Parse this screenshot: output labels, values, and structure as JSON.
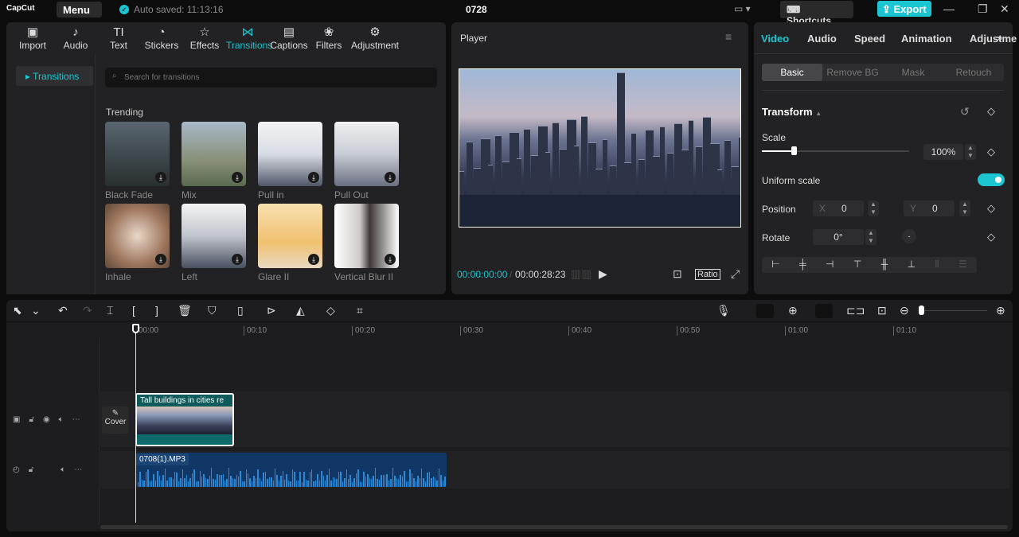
{
  "app": {
    "logo": "CapCut",
    "menu": "Menu",
    "autosave": "Auto saved: 11:13:16",
    "project": "0728",
    "shortcuts": "Shortcuts",
    "export": "Export"
  },
  "media_tabs": [
    {
      "icon": "▣",
      "label": "Import"
    },
    {
      "icon": "♪",
      "label": "Audio"
    },
    {
      "icon": "TI",
      "label": "Text"
    },
    {
      "icon": "◔",
      "label": "Stickers"
    },
    {
      "icon": "☆",
      "label": "Effects"
    },
    {
      "icon": "⋈",
      "label": "Transitions"
    },
    {
      "icon": "▤",
      "label": "Captions"
    },
    {
      "icon": "❀",
      "label": "Filters"
    },
    {
      "icon": "⚙",
      "label": "Adjustment"
    }
  ],
  "sidebar": {
    "item": "Transitions"
  },
  "search": {
    "placeholder": "Search for transitions"
  },
  "section": "Trending",
  "transitions": [
    "Black Fade",
    "Mix",
    "Pull in",
    "Pull Out",
    "Inhale",
    "Left",
    "Glare II",
    "Vertical Blur II"
  ],
  "player": {
    "title": "Player",
    "current": "00:00:00:00",
    "total": "00:00:28:23",
    "ratio": "Ratio"
  },
  "inspector": {
    "tabs": [
      "Video",
      "Audio",
      "Speed",
      "Animation",
      "Adjustme"
    ],
    "subtabs": [
      "Basic",
      "Remove BG",
      "Mask",
      "Retouch"
    ],
    "section": "Transform",
    "scale_label": "Scale",
    "scale_value": "100%",
    "scale_fraction": 0.2,
    "uniform_label": "Uniform scale",
    "uniform_on": true,
    "position_label": "Position",
    "x_label": "X",
    "x_value": "0",
    "y_label": "Y",
    "y_value": "0",
    "rotate_label": "Rotate",
    "rotate_value": "0°"
  },
  "timeline": {
    "ticks": [
      "00:00",
      "00:10",
      "00:20",
      "00:30",
      "00:40",
      "00:50",
      "01:00",
      "01:10"
    ],
    "cover": "Cover",
    "video_clip": "Tall buildings in cities re",
    "audio_clip": "0708(1).MP3"
  },
  "colors": {
    "accent": "#1bc6d2",
    "audio": "#103765",
    "clip": "#0f6b6b"
  }
}
